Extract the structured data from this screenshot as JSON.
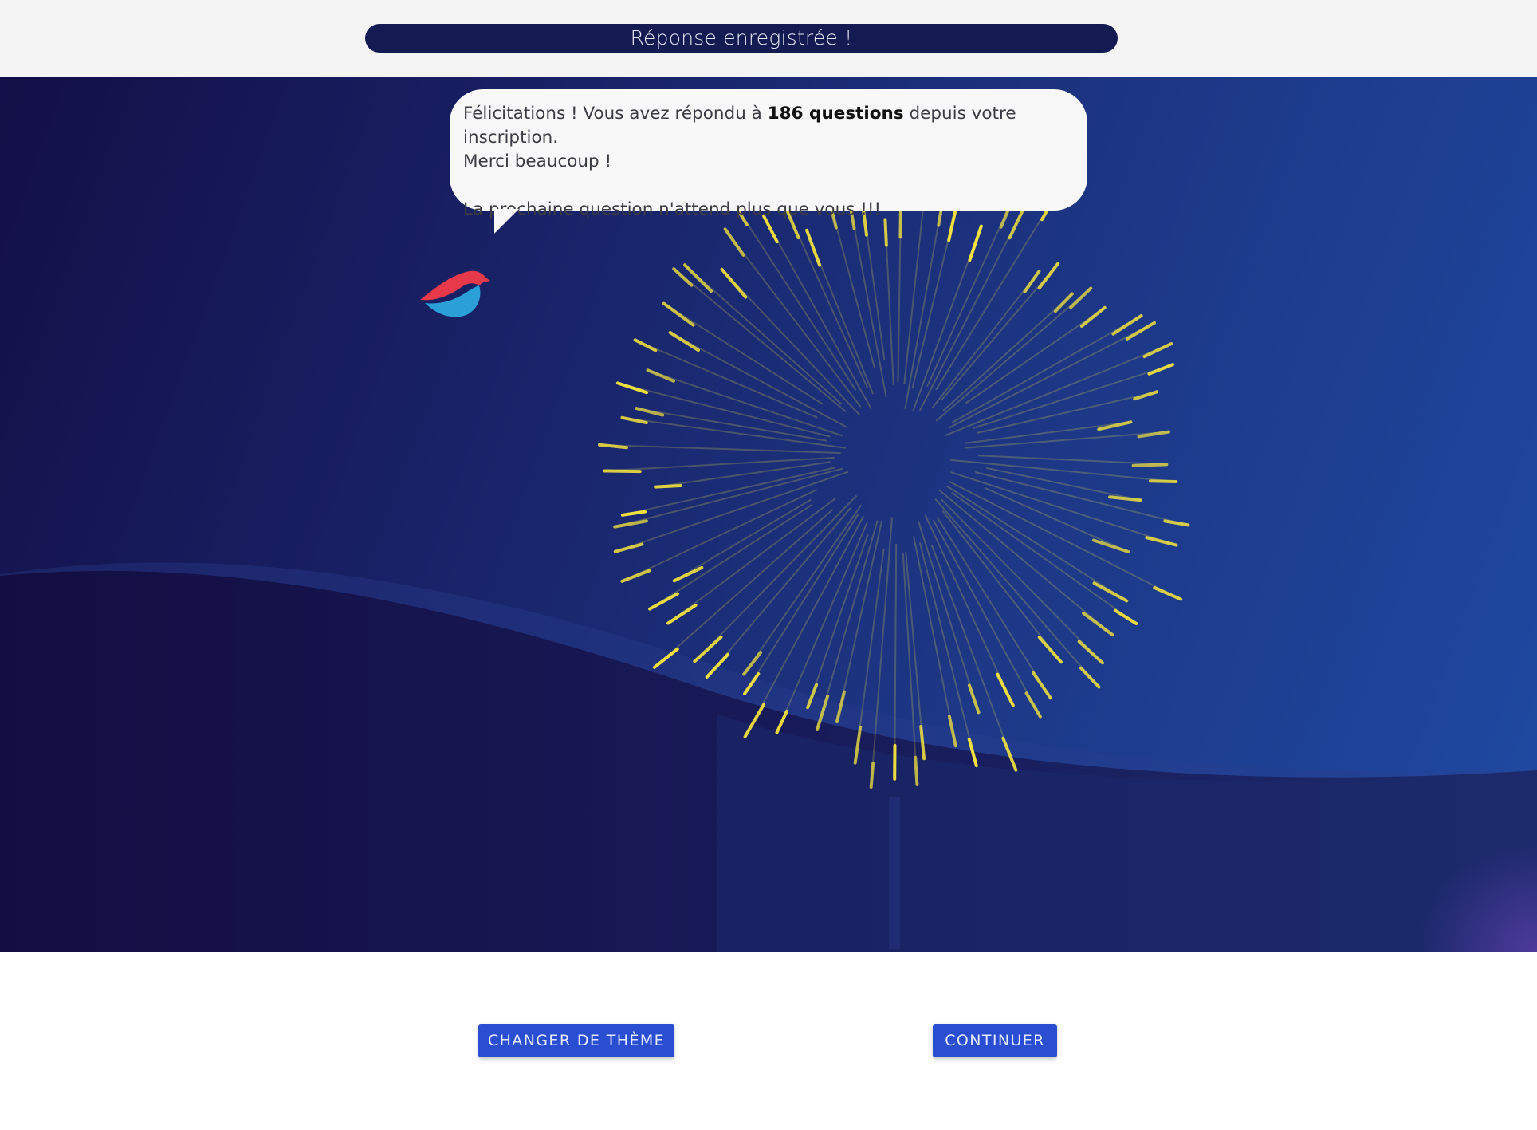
{
  "header": {
    "status_message": "Réponse enregistrée !"
  },
  "bubble": {
    "line1_before": "Félicitations ! Vous avez répondu à ",
    "line1_bold": "186 questions",
    "line1_after": " depuis votre inscription.",
    "line2": "Merci beaucoup !",
    "line3": "La prochaine question n'attend plus que vous !!!"
  },
  "actions": {
    "change_theme_label": "CHANGER DE THÈME",
    "continue_label": "CONTINUER"
  },
  "colors": {
    "accent": "#2a4ed1",
    "pill": "#141a52",
    "firework": "#f5e84a",
    "logo_red": "#e8394a",
    "logo_blue": "#2a9fd8"
  },
  "icons": {
    "mascot": "bird-logo-icon",
    "effect": "firework"
  }
}
